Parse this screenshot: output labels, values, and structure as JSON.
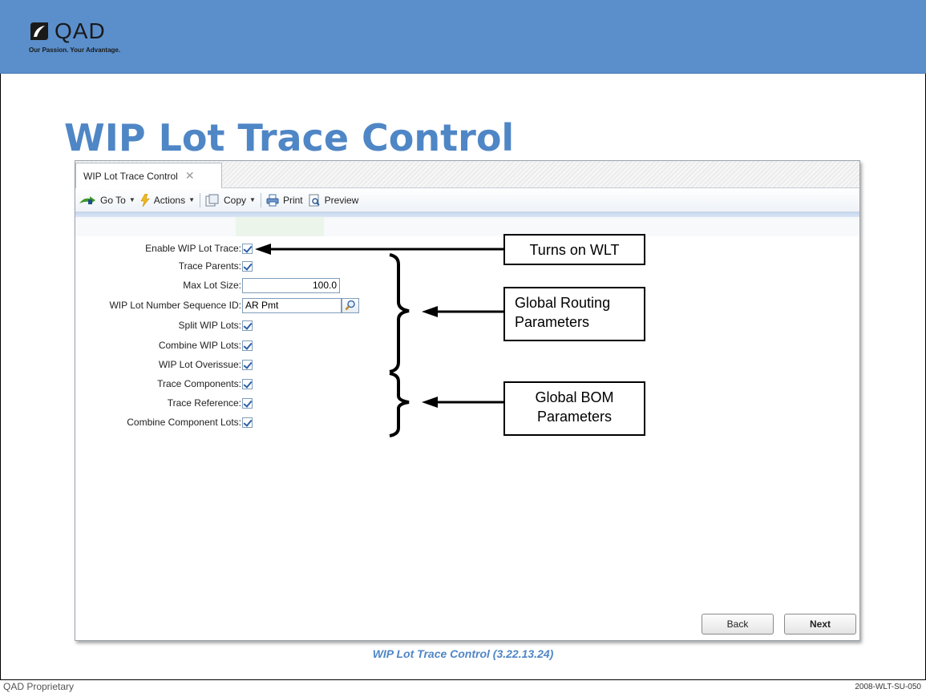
{
  "logo": {
    "text": "QAD",
    "tagline": "Our Passion. Your Advantage."
  },
  "slide": {
    "title": "WIP Lot Trace Control"
  },
  "window": {
    "tab_label": "WIP Lot Trace Control",
    "tab_close": "✕",
    "toolbar": {
      "goto_label": "Go To",
      "actions_label": "Actions",
      "copy_label": "Copy",
      "print_label": "Print",
      "preview_label": "Preview"
    },
    "fields": {
      "enable_wip_lot_trace": {
        "label": "Enable WIP Lot Trace:",
        "checked": true
      },
      "trace_parents": {
        "label": "Trace Parents:",
        "checked": true
      },
      "max_lot_size": {
        "label": "Max Lot Size:",
        "value": "100.0"
      },
      "sequence_id": {
        "label": "WIP Lot Number Sequence ID:",
        "value": "AR Pmt"
      },
      "split_wip_lots": {
        "label": "Split WIP Lots:",
        "checked": true
      },
      "combine_wip_lots": {
        "label": "Combine WIP Lots:",
        "checked": true
      },
      "wip_lot_overissue": {
        "label": "WIP Lot Overissue:",
        "checked": true
      },
      "trace_components": {
        "label": "Trace Components:",
        "checked": true
      },
      "trace_reference": {
        "label": "Trace Reference:",
        "checked": true
      },
      "combine_component_lots": {
        "label": "Combine Component Lots:",
        "checked": true
      }
    },
    "buttons": {
      "back": "Back",
      "next": "Next"
    }
  },
  "callouts": {
    "wlt": "Turns on WLT",
    "routing_line1": "Global Routing",
    "routing_line2": "Parameters",
    "bom_line1": "Global BOM",
    "bom_line2": "Parameters"
  },
  "caption": "WIP Lot Trace Control (3.22.13.24)",
  "footer": {
    "left": "QAD Proprietary",
    "right": "2008-WLT-SU-050"
  },
  "colors": {
    "header_band": "#5a8fcc",
    "title_blue": "#4f86c6",
    "checkbox": "#2f5fa8"
  }
}
